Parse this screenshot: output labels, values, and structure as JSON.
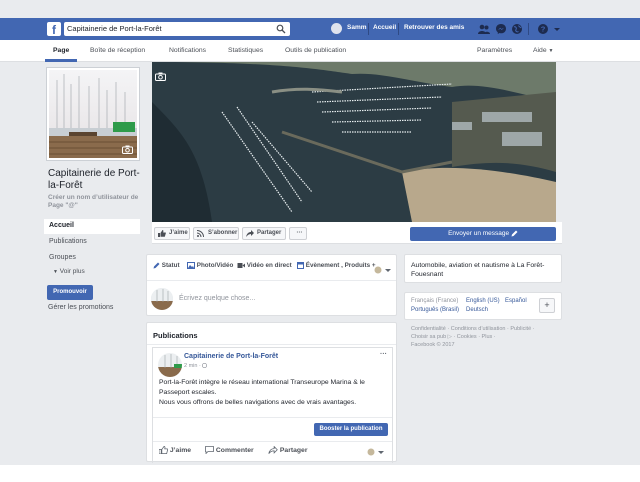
{
  "topbar": {
    "search_value": "Capitainerie de Port-la-Forêt",
    "user_name": "Samm",
    "home_label": "Accueil",
    "find_friends_label": "Retrouver des amis",
    "brand_color": "#4267b2"
  },
  "page_nav": {
    "items": [
      "Page",
      "Boîte de réception",
      "Notifications",
      "Statistiques",
      "Outils de publication"
    ],
    "settings_label": "Paramètres",
    "help_label": "Aide"
  },
  "left": {
    "page_name": "Capitainerie de Port-la-Forêt",
    "username_prompt": "Créer un nom d’utilisateur de Page \"@\"",
    "nav": [
      "Accueil",
      "Publications",
      "Groupes"
    ],
    "see_more": "Voir plus",
    "promote_button": "Promouvoir",
    "manage_promotions": "Gérer les promotions"
  },
  "cover_actions": {
    "like": "J’aime",
    "follow": "S’abonner",
    "share": "Partager",
    "more": "···",
    "send_message": "Envoyer un message"
  },
  "composer": {
    "tabs": [
      "Statut",
      "Photo/Vidéo",
      "Vidéo en direct",
      "Évènement , Produits +"
    ],
    "placeholder": "Écrivez quelque chose..."
  },
  "publications": {
    "heading": "Publications",
    "post": {
      "author": "Capitainerie de Port-la-Forêt",
      "time": "2 min",
      "lines": [
        "Port-la-Forêt intègre le réseau international Transeurope Marina & le Passeport escales.",
        "Nous vous offrons de belles navigations avec de vrais avantages."
      ],
      "more": "···",
      "boost_button": "Booster la publication",
      "actions": [
        "J’aime",
        "Commenter",
        "Partager"
      ]
    }
  },
  "right": {
    "category": "Automobile, aviation et nautisme à La Forêt-Fouesnant",
    "languages": {
      "current": "Français (France)",
      "others": [
        "English (US)",
        "Español",
        "Português (Brasil)",
        "Deutsch"
      ],
      "add": "+"
    },
    "footer": {
      "line1": "Confidentialité · Conditions d’utilisation · Publicité ·",
      "line2": "Choisir sa pub ▷ · Cookies · Plus ·",
      "line3": "Facebook © 2017"
    }
  }
}
